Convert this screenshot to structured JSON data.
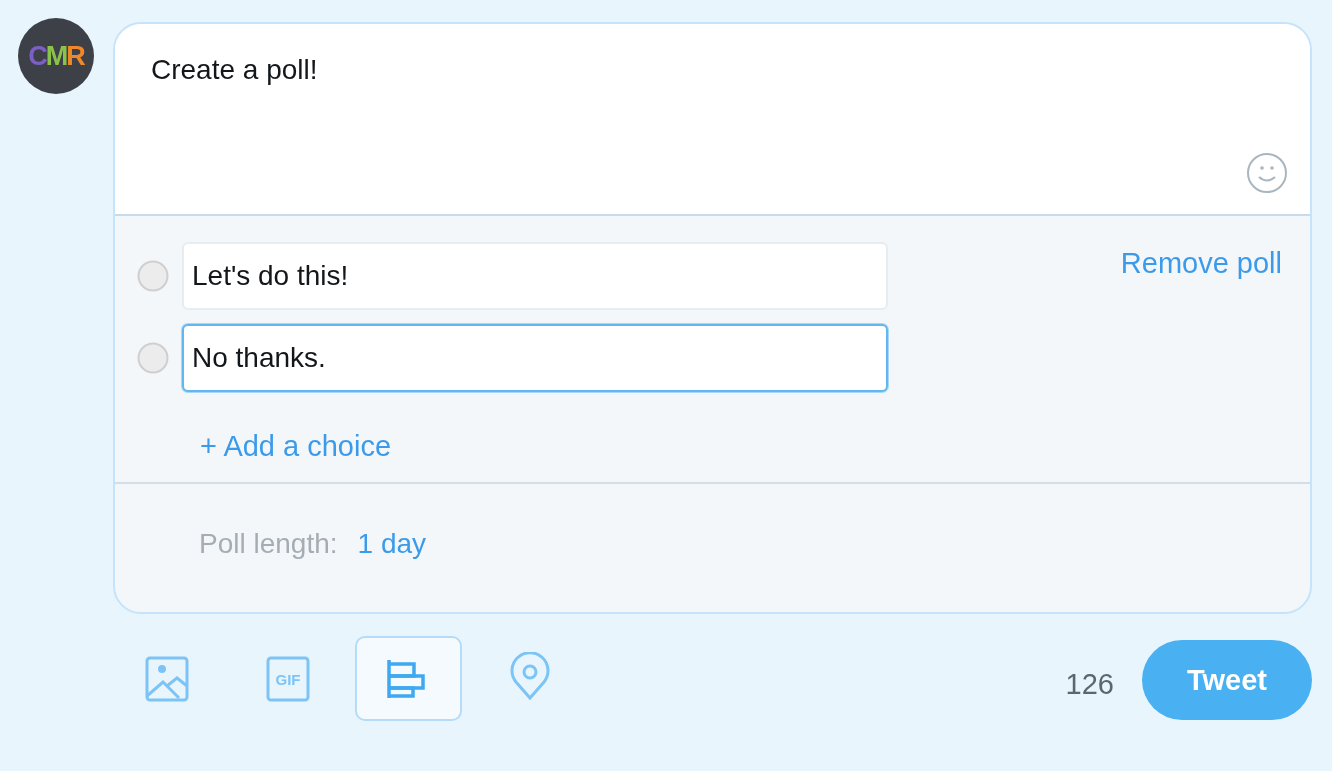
{
  "avatar": {
    "letters": [
      "C",
      "M",
      "R"
    ]
  },
  "composer": {
    "text": "Create a poll!"
  },
  "poll": {
    "choices": [
      {
        "value": "Let's do this!",
        "focused": false
      },
      {
        "value": "No thanks.",
        "focused": true
      }
    ],
    "remove_label": "Remove poll",
    "add_label": "+ Add a choice",
    "length_label": "Poll length:",
    "length_value": "1 day"
  },
  "toolbar": [
    {
      "kind": "image",
      "selected": false
    },
    {
      "kind": "gif",
      "label": "GIF",
      "selected": false
    },
    {
      "kind": "poll",
      "selected": true
    },
    {
      "kind": "location",
      "selected": false
    }
  ],
  "counter": "126",
  "tweet_button": "Tweet"
}
